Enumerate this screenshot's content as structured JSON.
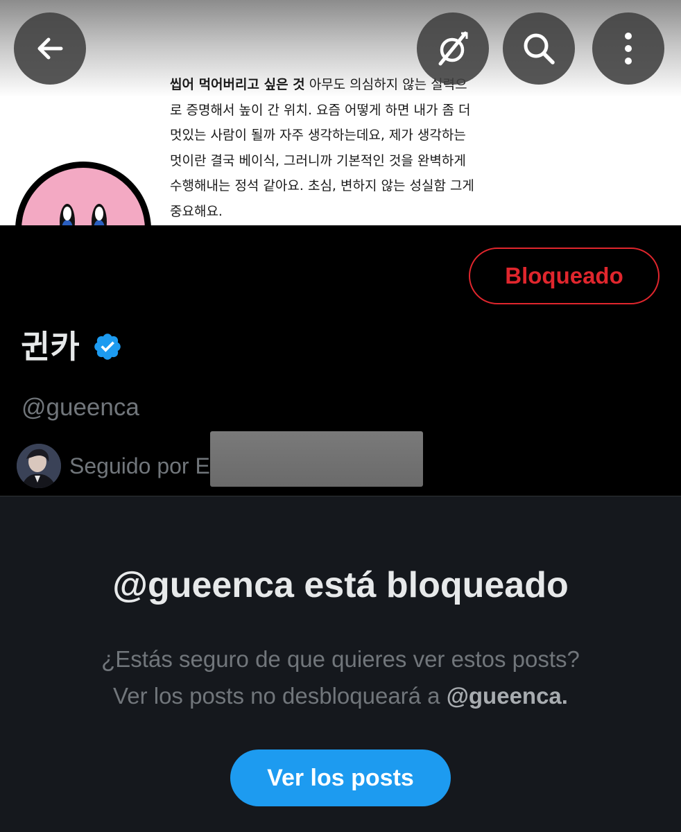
{
  "header": {
    "back_icon": "arrow-left-icon",
    "grok_icon": "grok-icon",
    "search_icon": "search-icon",
    "more_icon": "more-vertical-icon",
    "banner_text_bold": "씹어 먹어버리고 싶은 것",
    "banner_text_rest_line1": " 아무도 의심하지 않는 실력으",
    "banner_text_line2": "로 증명해서 높이 간 위치. 요즘 어떻게 하면 내가 좀 더",
    "banner_text_line3": "멋있는 사람이 될까 자주 생각하는데요, 제가 생각하는",
    "banner_text_line4": "멋이란 결국 베이식, 그러니까 기본적인 것을 완벽하게",
    "banner_text_line5": "수행해내는 정석 같아요. 초심, 변하지 않는 성실함 그게",
    "banner_text_line6": "중요해요."
  },
  "profile": {
    "display_name": "귄카",
    "verified": true,
    "handle": "@gueenca",
    "followed_by": "Seguido por E",
    "block_button_label": "Bloqueado",
    "block_color": "#e0262d"
  },
  "blocked": {
    "title": "@gueenca está bloqueado",
    "desc_line1": "¿Estás seguro de que quieres ver estos posts?",
    "desc_line2_prefix": "Ver los posts no desbloqueará a ",
    "desc_line2_handle": "@gueenca.",
    "view_button_label": "Ver los posts",
    "accent": "#1d9bf0"
  }
}
